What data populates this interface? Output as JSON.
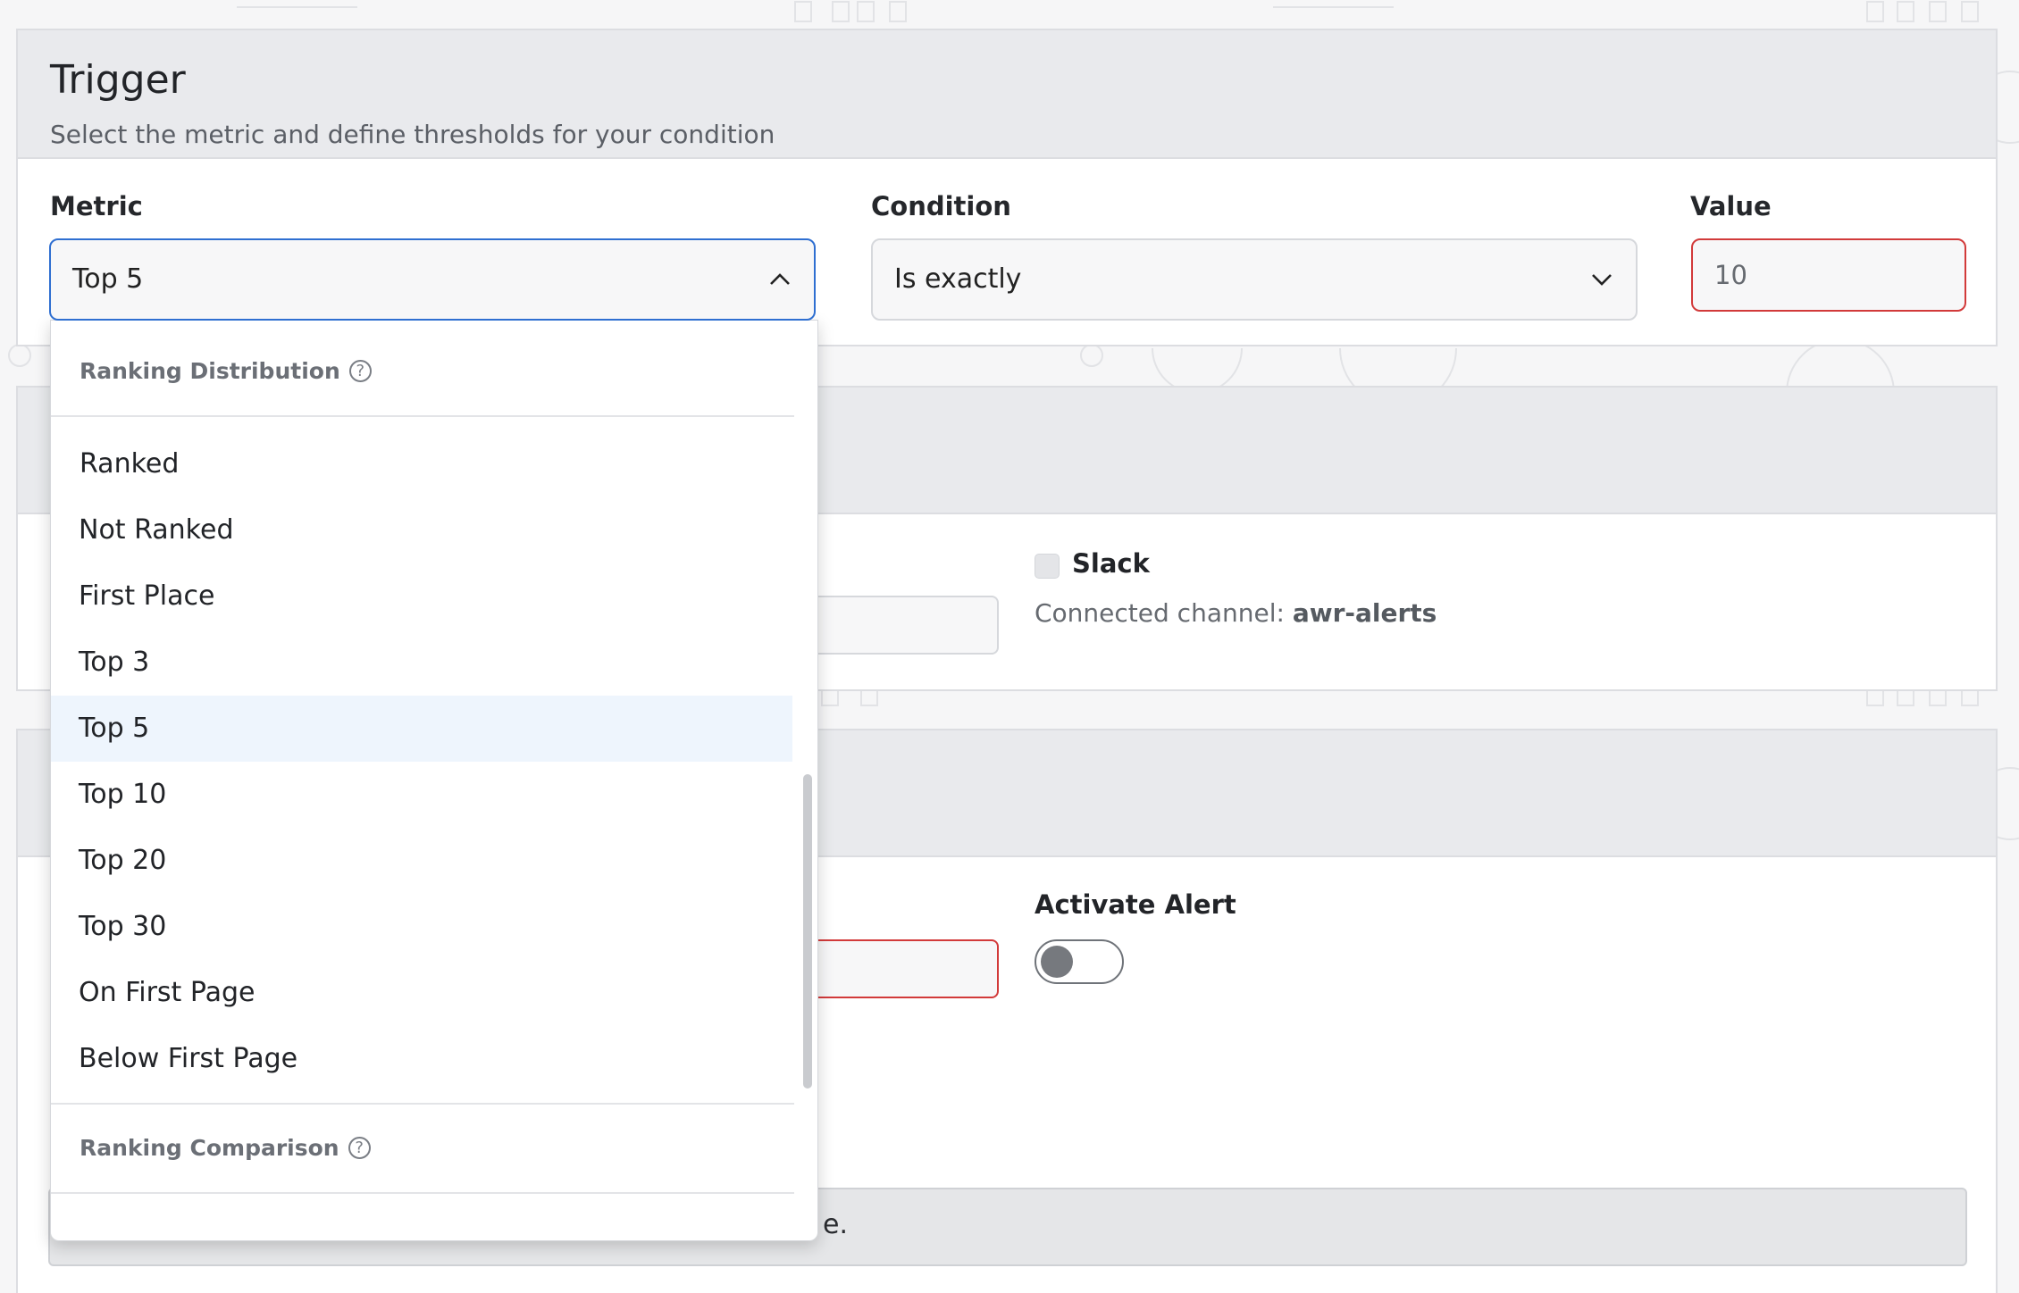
{
  "trigger": {
    "title": "Trigger",
    "subtitle": "Select the metric and define thresholds for your condition"
  },
  "metric": {
    "label": "Metric",
    "selected": "Top 5"
  },
  "condition": {
    "label": "Condition",
    "selected": "Is exactly"
  },
  "value": {
    "label": "Value",
    "value": "10"
  },
  "dropdown": {
    "group1": "Ranking Distribution",
    "options": [
      "Ranked",
      "Not Ranked",
      "First Place",
      "Top 3",
      "Top 5",
      "Top 10",
      "Top 20",
      "Top 30",
      "On First Page",
      "Below First Page"
    ],
    "selected_option": "Top 5",
    "group2": "Ranking Comparison"
  },
  "notifications": {
    "slack_label": "Slack",
    "connected_prefix": "Connected channel: ",
    "connected_channel": "awr-alerts"
  },
  "activate": {
    "label": "Activate Alert",
    "enabled": false
  },
  "bottom_bar": {
    "text_fragment": "e."
  },
  "colors": {
    "accent_blue": "#2f6fd1",
    "error_red": "#d23a3a",
    "selected_bg": "#eef5fd"
  }
}
